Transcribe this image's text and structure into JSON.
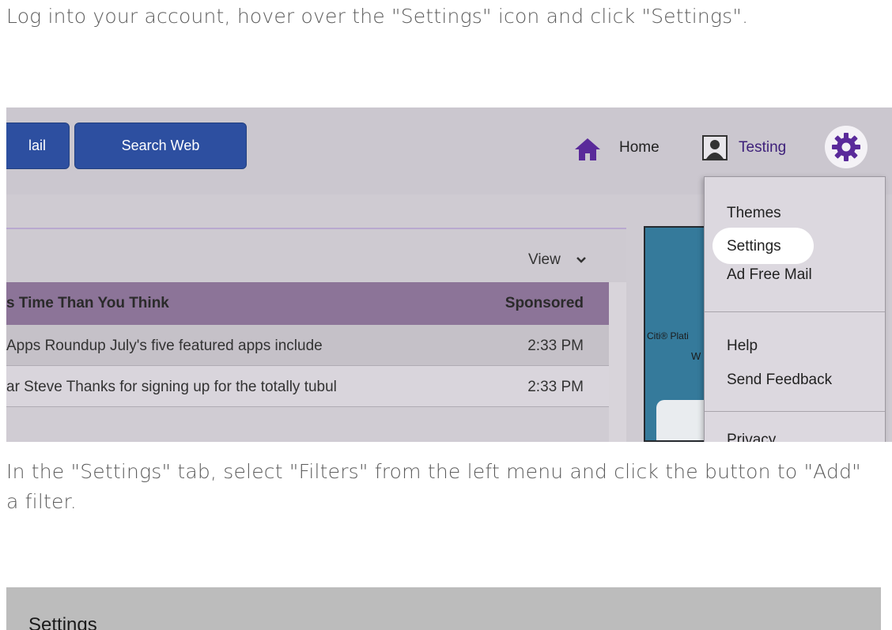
{
  "instructions": {
    "step1": "Log into your account, hover over the \"Settings\" icon and click \"Settings\".",
    "step2": "In the \"Settings\" tab, select \"Filters\" from the left menu and click the button to \"Add\" a filter."
  },
  "screenshot1": {
    "toolbar": {
      "mail_button_label": "lail",
      "search_web_button_label": "Search Web"
    },
    "header": {
      "home_label": "Home",
      "user_label": "Testing",
      "icons": [
        "home-icon",
        "avatar-icon",
        "gear-icon"
      ]
    },
    "menu": {
      "items": [
        "Themes",
        "Settings",
        "Ad Free Mail",
        "Help",
        "Send Feedback",
        "Privacy"
      ],
      "highlighted": "Settings"
    },
    "mail_list": {
      "view_label": "View",
      "rows": [
        {
          "subject": "s Time Than You Think",
          "time": "Sponsored"
        },
        {
          "subject": " Apps Roundup July's five featured apps include",
          "time": "2:33 PM"
        },
        {
          "subject": "ar Steve Thanks for signing up for the totally tubul",
          "time": "2:33 PM"
        }
      ]
    },
    "ad": {
      "line1": "Citi® Plati",
      "line2": "W"
    },
    "colors": {
      "accent_purple": "#5a2a9a",
      "button_blue": "#2d4fa0",
      "sponsored_row": "#8c7498"
    }
  },
  "screenshot2": {
    "title": "Settings"
  }
}
